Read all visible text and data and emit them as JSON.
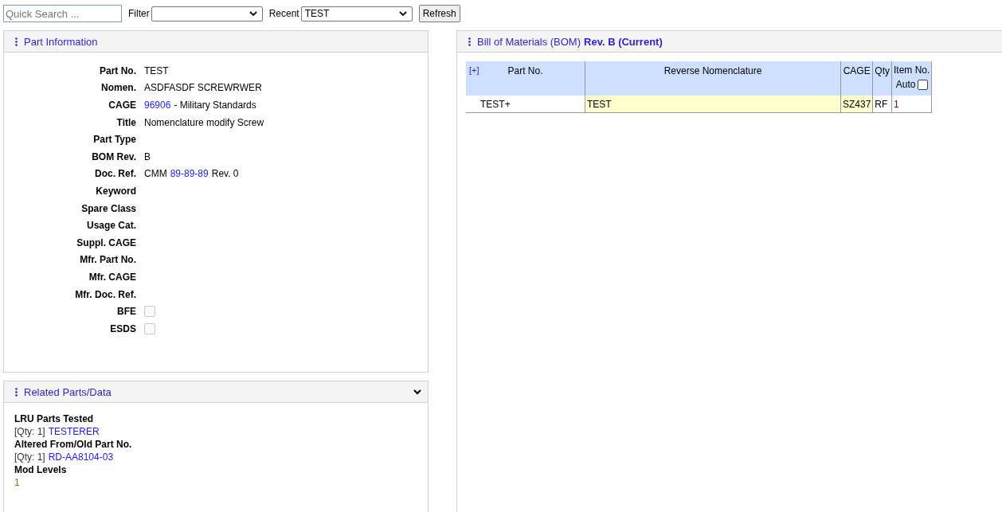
{
  "toolbar": {
    "search": {
      "placeholder": "Quick Search ..."
    },
    "filter": {
      "label": "Filter"
    },
    "recent": {
      "label": "Recent",
      "value": "TEST"
    },
    "refresh": "Refresh"
  },
  "part_information": {
    "title": "Part Information",
    "fields": [
      {
        "label": "Part No.",
        "kind": "text",
        "segments": [
          {
            "kind": "text",
            "text": "TEST"
          }
        ]
      },
      {
        "label": "Nomen.",
        "kind": "text",
        "segments": [
          {
            "kind": "text",
            "text": "ASDFASDF SCREWRWER"
          }
        ]
      },
      {
        "label": "CAGE",
        "kind": "text",
        "segments": [
          {
            "kind": "link",
            "text": "96906"
          },
          {
            "kind": "text",
            "text": "- Military Standards"
          }
        ]
      },
      {
        "label": "Title",
        "kind": "text",
        "segments": [
          {
            "kind": "text",
            "text": "Nomenclature modify Screw"
          }
        ]
      },
      {
        "label": "Part Type",
        "kind": "text"
      },
      {
        "label": "BOM Rev.",
        "kind": "text",
        "segments": [
          {
            "kind": "text",
            "text": "B"
          }
        ]
      },
      {
        "label": "Doc. Ref.",
        "kind": "text",
        "segments": [
          {
            "kind": "text",
            "text": "CMM"
          },
          {
            "kind": "link",
            "text": "89-89-89"
          },
          {
            "kind": "text",
            "text": "Rev. 0"
          }
        ]
      },
      {
        "label": "Keyword",
        "kind": "text"
      },
      {
        "label": "Spare Class",
        "kind": "text"
      },
      {
        "label": "Usage Cat.",
        "kind": "text"
      },
      {
        "label": "Suppl. CAGE",
        "kind": "text"
      },
      {
        "label": "Mfr. Part No.",
        "kind": "text"
      },
      {
        "label": "Mfr. CAGE",
        "kind": "text"
      },
      {
        "label": "Mfr. Doc. Ref.",
        "kind": "text"
      },
      {
        "label": "BFE",
        "kind": "checkbox",
        "checked": false,
        "disabled": true
      },
      {
        "label": "ESDS",
        "kind": "checkbox",
        "checked": false,
        "disabled": true
      }
    ]
  },
  "related_parts": {
    "title": "Related Parts/Data",
    "expanded": true,
    "groups": [
      {
        "heading": "LRU Parts Tested",
        "qty": "[Qty: 1]",
        "value": "TESTERER",
        "kind": "link"
      },
      {
        "heading": "Altered From/Old Part No.",
        "qty": "[Qty: 1]",
        "value": "RD-AA8104-03",
        "kind": "link"
      },
      {
        "heading": "Mod Levels",
        "value": "1",
        "kind": "text"
      }
    ]
  },
  "bom": {
    "title": "Bill of Materials (BOM)",
    "revision": "Rev. B (Current)",
    "expand": "[+]",
    "columns": [
      "Part No.",
      "Reverse Nomenclature",
      "CAGE",
      "Qty",
      "Item No."
    ],
    "auto": {
      "label": "Auto",
      "checked": false
    },
    "rows": [
      {
        "part_no": "TEST+",
        "nomenclature": "TEST",
        "cage": "SZ437",
        "qty": "RF",
        "item_no": "1"
      }
    ]
  }
}
